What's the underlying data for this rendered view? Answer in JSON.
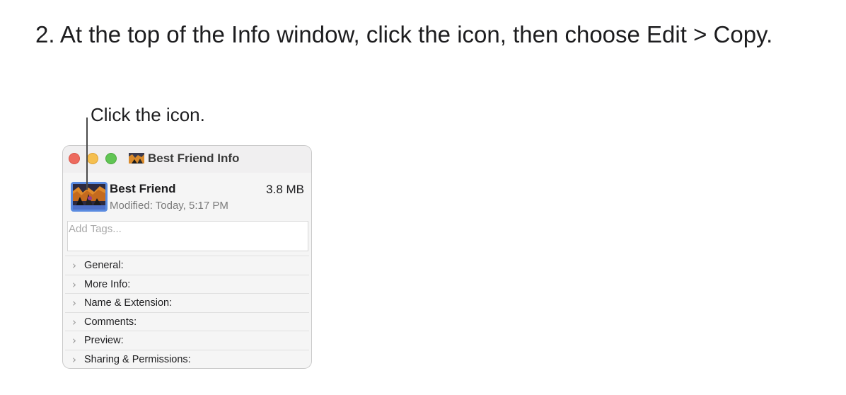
{
  "instruction": {
    "step_text": "2. At the top of the Info window, click the icon, then choose Edit > Copy."
  },
  "callout": {
    "text": "Click the icon."
  },
  "window": {
    "title": "Best Friend Info",
    "file_name": "Best Friend",
    "file_size": "3.8 MB",
    "modified": "Modified: Today, 5:17 PM",
    "tags_placeholder": "Add Tags...",
    "sections": [
      {
        "label": "General:"
      },
      {
        "label": "More Info:"
      },
      {
        "label": "Name & Extension:"
      },
      {
        "label": "Comments:"
      },
      {
        "label": "Preview:"
      },
      {
        "label": "Sharing & Permissions:"
      }
    ],
    "icons": {
      "section_chevron": "chevron-right-icon",
      "file_thumbnail": "photo-thumbnail-icon"
    },
    "colors": {
      "close": "#ed6a5e",
      "minimize": "#f5bf4f",
      "zoom": "#61c554",
      "icon_selection": "#5a8be0"
    }
  }
}
